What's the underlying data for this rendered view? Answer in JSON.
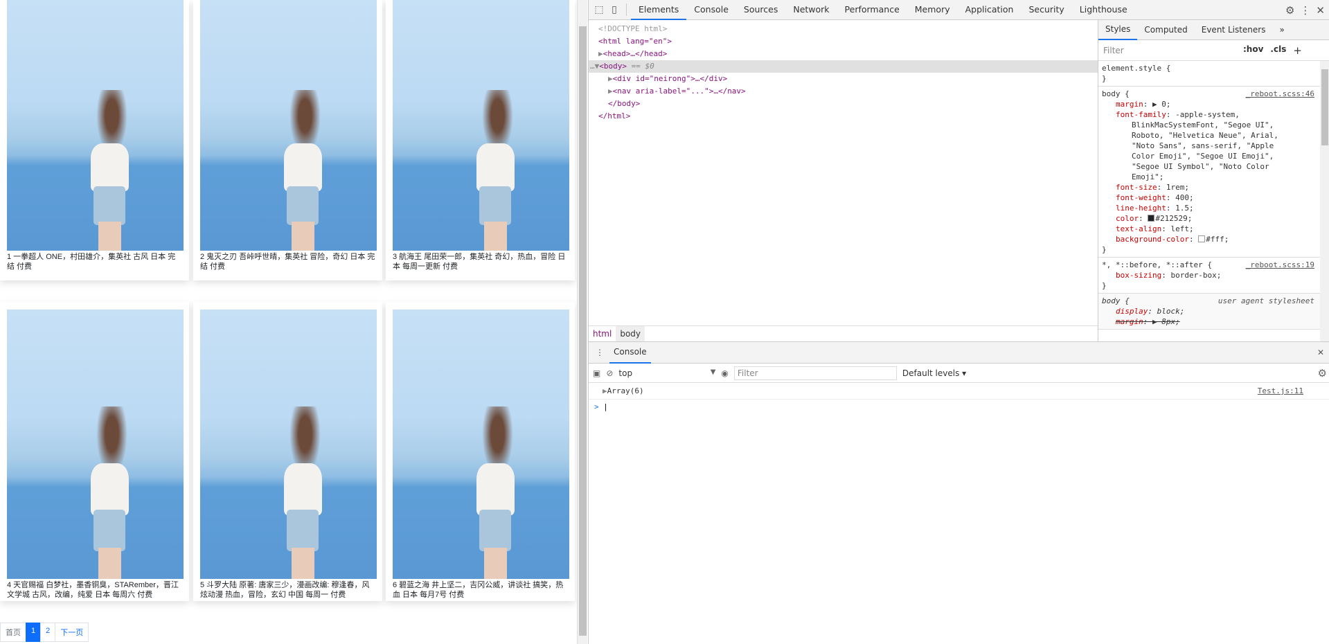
{
  "page": {
    "cards": [
      {
        "caption": "1 一拳超人 ONE，村田雄介，集英社 古风 日本 完结 付费"
      },
      {
        "caption": "2 鬼灭之刃 吾峠呼世晴，集英社 冒险，奇幻 日本 完结 付费"
      },
      {
        "caption": "3 航海王 尾田荣一郎，集英社 奇幻，热血，冒险 日本 每周一更新 付费"
      },
      {
        "caption": "4 天官赐福 白梦社，墨香铜臭，STARember，晋江文学城 古风，改编，纯爱 日本 每周六 付费"
      },
      {
        "caption": "5 斗罗大陆 原著: 唐家三少，漫画改编: 穆逢春，风炫动漫 热血，冒险，玄幻 中国 每周一 付费"
      },
      {
        "caption": "6 碧蓝之海 井上坚二，吉冈公威，讲谈社 搞笑，热血 日本 每月7号 付费"
      }
    ],
    "pagination": {
      "first": "首页",
      "pages": [
        "1",
        "2"
      ],
      "current": "1",
      "next": "下一页"
    }
  },
  "devtools": {
    "tabs": [
      "Elements",
      "Console",
      "Sources",
      "Network",
      "Performance",
      "Memory",
      "Application",
      "Security",
      "Lighthouse"
    ],
    "active_tab": "Elements",
    "dom": {
      "doctype": "<!DOCTYPE html>",
      "html_open": "<html lang=\"en\">",
      "head": "<head>…</head>",
      "body": "<body>",
      "body_marker": "== $0",
      "div": "<div id=\"neirong\">…</div>",
      "nav": "<nav aria-label=\"...\">…</nav>",
      "body_close": "</body>",
      "html_close": "</html>"
    },
    "breadcrumbs": [
      "html",
      "body"
    ],
    "styles": {
      "tabs": [
        "Styles",
        "Computed",
        "Event Listeners",
        "»"
      ],
      "filter_placeholder": "Filter",
      "hov": ":hov",
      "cls": ".cls",
      "plus": "+",
      "element_style": "element.style {",
      "rule1_selector": "body {",
      "rule1_source": "_reboot.scss:46",
      "rule1_props": [
        {
          "n": "margin",
          "v": "▶ 0;"
        },
        {
          "n": "font-family",
          "v": "-apple-system,"
        },
        {
          "n": "",
          "v": "BlinkMacSystemFont, \"Segoe UI\","
        },
        {
          "n": "",
          "v": "Roboto, \"Helvetica Neue\", Arial,"
        },
        {
          "n": "",
          "v": "\"Noto Sans\", sans-serif, \"Apple"
        },
        {
          "n": "",
          "v": "Color Emoji\", \"Segoe UI Emoji\","
        },
        {
          "n": "",
          "v": "\"Segoe UI Symbol\", \"Noto Color"
        },
        {
          "n": "",
          "v": "Emoji\";"
        },
        {
          "n": "font-size",
          "v": "1rem;"
        },
        {
          "n": "font-weight",
          "v": "400;"
        },
        {
          "n": "line-height",
          "v": "1.5;"
        },
        {
          "n": "color",
          "v": "#212529;"
        },
        {
          "n": "text-align",
          "v": "left;"
        },
        {
          "n": "background-color",
          "v": "#fff;"
        }
      ],
      "color_swatch": "#212529",
      "bg_swatch": "#ffffff",
      "rule2_selector": "*, *::before, *::after {",
      "rule2_source": "_reboot.scss:19",
      "rule2_prop": "box-sizing",
      "rule2_val": "border-box;",
      "rule3_selector": "body {",
      "rule3_source": "user agent stylesheet",
      "rule3_prop1": "display",
      "rule3_val1": "block;",
      "rule3_prop2": "margin",
      "rule3_val2": "▶ 8px;",
      "close": "}"
    },
    "console": {
      "tab": "Console",
      "context": "top",
      "filter_placeholder": "Filter",
      "levels": "Default levels ▾",
      "message": "Array(6)",
      "message_source": "Test.js:11",
      "prompt": ">"
    }
  }
}
